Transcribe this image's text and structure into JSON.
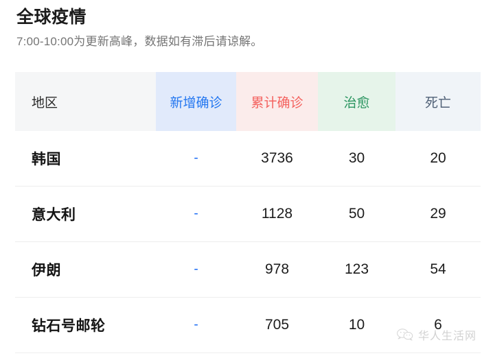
{
  "header": {
    "title": "全球疫情",
    "subtitle": "7:00-10:00为更新高峰，数据如有滞后请谅解。"
  },
  "table": {
    "columns": [
      {
        "key": "region",
        "label": "地区",
        "text_color": "#2b2b2b",
        "bg_color": "#f5f6f7"
      },
      {
        "key": "new",
        "label": "新增确诊",
        "text_color": "#2477f0",
        "bg_color": "#e1eafb"
      },
      {
        "key": "total",
        "label": "累计确诊",
        "text_color": "#f4625f",
        "bg_color": "#fbeceb"
      },
      {
        "key": "cured",
        "label": "治愈",
        "text_color": "#29945f",
        "bg_color": "#e6f4ea"
      },
      {
        "key": "dead",
        "label": "死亡",
        "text_color": "#4f6076",
        "bg_color": "#f0f4f8"
      }
    ],
    "rows": [
      {
        "region": "韩国",
        "new": "-",
        "total": "3736",
        "cured": "30",
        "dead": "20"
      },
      {
        "region": "意大利",
        "new": "-",
        "total": "1128",
        "cured": "50",
        "dead": "29"
      },
      {
        "region": "伊朗",
        "new": "-",
        "total": "978",
        "cured": "123",
        "dead": "54"
      },
      {
        "region": "钻石号邮轮",
        "new": "-",
        "total": "705",
        "cured": "10",
        "dead": "6"
      }
    ]
  },
  "watermark": {
    "icon": "wechat-icon",
    "text": "华人生活网"
  }
}
